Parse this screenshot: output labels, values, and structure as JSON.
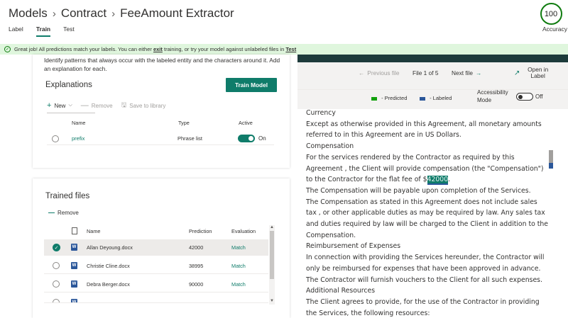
{
  "breadcrumb": [
    "Models",
    "Contract",
    "FeeAmount Extractor"
  ],
  "tabs": [
    {
      "label": "Label"
    },
    {
      "label": "Train"
    },
    {
      "label": "Test"
    }
  ],
  "accuracy": {
    "value": "100",
    "label": "Accuracy"
  },
  "banner": {
    "prefix": "Great job! All predictions match your labels. You can either",
    "link1": "exit",
    "middle": "training, or try your model against unlabeled files in",
    "link2": "Test"
  },
  "explanations_panel": {
    "description": "Identify patterns that always occur with the labeled entity and the characters around it. Add an explanation for each.",
    "title": "Explanations",
    "train_button": "Train Model",
    "commands": {
      "new": "New",
      "remove": "Remove",
      "save": "Save to library"
    },
    "columns": {
      "name": "Name",
      "type": "Type",
      "active": "Active"
    },
    "rows": [
      {
        "name": "prefix",
        "type": "Phrase list",
        "active": "On"
      }
    ]
  },
  "trained_files": {
    "title": "Trained files",
    "remove": "Remove",
    "columns": {
      "name": "Name",
      "prediction": "Prediction",
      "evaluation": "Evaluation"
    },
    "rows": [
      {
        "name": "Allan Deyoung.docx",
        "prediction": "42000",
        "evaluation": "Match"
      },
      {
        "name": "Christie Cline.docx",
        "prediction": "38995",
        "evaluation": "Match"
      },
      {
        "name": "Debra Berger.docx",
        "prediction": "90000",
        "evaluation": "Match"
      }
    ]
  },
  "viewer": {
    "previous": "Previous file",
    "position": "File 1 of 5",
    "next": "Next file",
    "open": "Open in Label",
    "legend_predicted": "- Predicted",
    "legend_labeled": "- Labeled",
    "accessibility": "Accessibility Mode",
    "accessibility_state": "Off",
    "colors": {
      "predicted": "#13a10e",
      "labeled": "#2b579a"
    }
  },
  "document": {
    "p1": "Currency",
    "p2": "Except as otherwise provided in this Agreement, all monetary amounts referred to in this Agreement are in US Dollars.",
    "p3": "Compensation",
    "p4_before": "For the services rendered by the Contractor as required by this Agreement , the Client will provide compensation (the \"Compensation\") to the Contractor for the flat fee of $",
    "p4_highlight": "42000",
    "p4_after": ".",
    "p5": "The Compensation will be payable upon completion of the Services.",
    "p6": "The Compensation as stated in this Agreement does not include sales tax , or other applicable duties as may be required by law. Any sales tax and duties required by law will be charged to the Client in addition to the Compensation.",
    "p7": "Reimbursement of Expenses",
    "p8": "In connection with providing the Services hereunder, the Contractor will only be reimbursed for expenses that have been approved in advance.",
    "p9": "The Contractor will furnish vouchers to the Client for all such expenses.",
    "p10": "Additional Resources",
    "p11": "The Client agrees to provide, for the use of the Contractor in providing the Services, the following resources:"
  }
}
